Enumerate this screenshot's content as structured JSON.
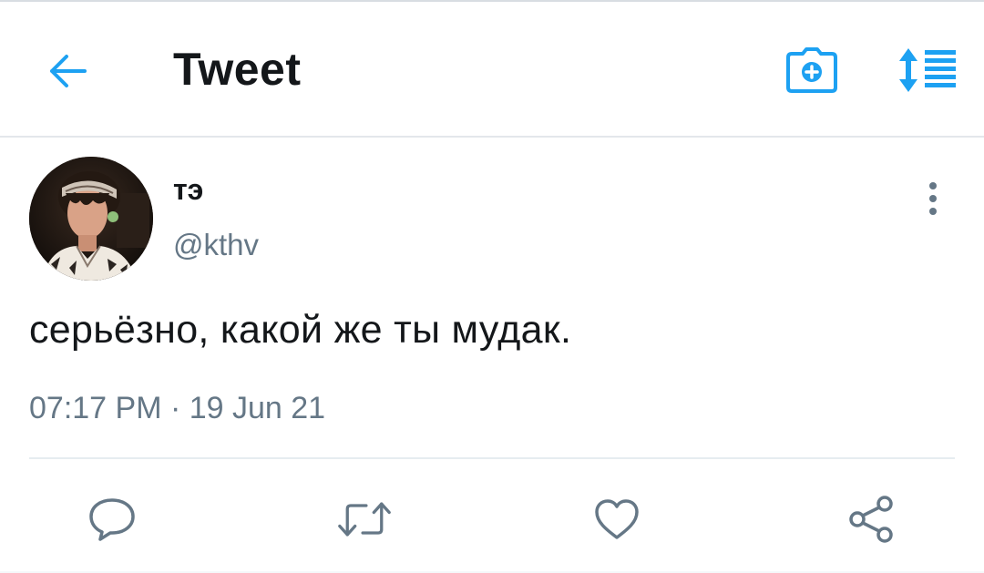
{
  "header": {
    "title": "Tweet",
    "back_icon": "arrow-left-icon",
    "camera_icon": "camera-plus-icon",
    "sort_icon": "sort-list-icon",
    "accent_color": "#1da1f2"
  },
  "tweet": {
    "display_name": "тэ",
    "handle": "@kthv",
    "text": "серьёзно, какой же ты мудак.",
    "timestamp": "07:17 PM · 19 Jun 21",
    "more_icon": "more-vertical-icon"
  },
  "actions": [
    {
      "name": "reply",
      "icon": "reply-icon"
    },
    {
      "name": "retweet",
      "icon": "retweet-icon"
    },
    {
      "name": "like",
      "icon": "heart-icon"
    },
    {
      "name": "share",
      "icon": "share-icon"
    }
  ],
  "colors": {
    "text_primary": "#14171a",
    "text_secondary": "#657786",
    "icon_gray": "#657786",
    "divider": "#e6ecf0"
  }
}
